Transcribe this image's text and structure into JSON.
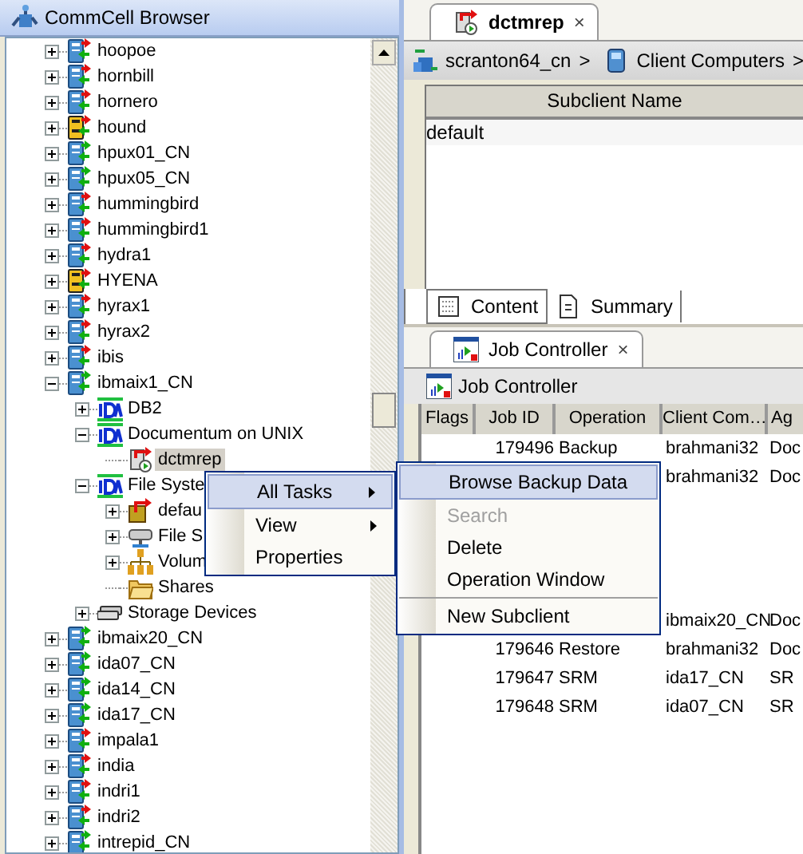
{
  "browser": {
    "title": "CommCell Browser",
    "tree": [
      {
        "label": "hoopoe",
        "kind": "client_alert",
        "expanded": false,
        "selected": false
      },
      {
        "label": "hornbill",
        "kind": "client_alert",
        "expanded": false,
        "selected": false
      },
      {
        "label": "hornero",
        "kind": "client_alert",
        "expanded": false,
        "selected": false
      },
      {
        "label": "hound",
        "kind": "client_legacy",
        "expanded": false,
        "selected": false
      },
      {
        "label": "hpux01_CN",
        "kind": "client_ok",
        "expanded": false,
        "selected": false
      },
      {
        "label": "hpux05_CN",
        "kind": "client_ok",
        "expanded": false,
        "selected": false
      },
      {
        "label": "hummingbird",
        "kind": "client_alert",
        "expanded": false,
        "selected": false
      },
      {
        "label": "hummingbird1",
        "kind": "client_alert",
        "expanded": false,
        "selected": false
      },
      {
        "label": "hydra1",
        "kind": "client_alert",
        "expanded": false,
        "selected": false
      },
      {
        "label": "HYENA",
        "kind": "client_legacy",
        "expanded": false,
        "selected": false
      },
      {
        "label": "hyrax1",
        "kind": "client_alert",
        "expanded": false,
        "selected": false
      },
      {
        "label": "hyrax2",
        "kind": "client_alert",
        "expanded": false,
        "selected": false
      },
      {
        "label": "ibis",
        "kind": "client_alert",
        "expanded": false,
        "selected": false
      },
      {
        "label": "ibmaix1_CN",
        "kind": "client_ok",
        "expanded": true,
        "selected": false,
        "children": [
          {
            "label": "DB2",
            "kind": "agent",
            "expanded": false,
            "selected": false
          },
          {
            "label": "Documentum on UNIX",
            "kind": "agent",
            "expanded": true,
            "selected": false,
            "children": [
              {
                "label": "dctmrep",
                "kind": "subclient",
                "selected": true
              }
            ]
          },
          {
            "label": "File Syste",
            "kind": "agent",
            "expanded": true,
            "selected": false,
            "children": [
              {
                "label": "defau",
                "kind": "default_subclient",
                "expanded": false,
                "selected": false
              },
              {
                "label": "File S",
                "kind": "drive",
                "expanded": false,
                "selected": false
              },
              {
                "label": "Volum",
                "kind": "volume_groups",
                "expanded": false,
                "selected": false
              },
              {
                "label": "Shares",
                "kind": "shares",
                "selected": false
              }
            ]
          },
          {
            "label": "Storage Devices",
            "kind": "storage",
            "expanded": false,
            "selected": false
          }
        ]
      },
      {
        "label": "ibmaix20_CN",
        "kind": "client_ok",
        "expanded": false,
        "selected": false
      },
      {
        "label": "ida07_CN",
        "kind": "client_ok",
        "expanded": false,
        "selected": false
      },
      {
        "label": "ida14_CN",
        "kind": "client_ok",
        "expanded": false,
        "selected": false
      },
      {
        "label": "ida17_CN",
        "kind": "client_ok",
        "expanded": false,
        "selected": false
      },
      {
        "label": "impala1",
        "kind": "client_alert",
        "expanded": false,
        "selected": false
      },
      {
        "label": "india",
        "kind": "client_alert",
        "expanded": false,
        "selected": false
      },
      {
        "label": "indri1",
        "kind": "client_alert",
        "expanded": false,
        "selected": false
      },
      {
        "label": "indri2",
        "kind": "client_alert",
        "expanded": false,
        "selected": false
      },
      {
        "label": "intrepid_CN",
        "kind": "client_ok",
        "expanded": false,
        "selected": false
      }
    ]
  },
  "editor": {
    "tabs": [
      {
        "label": "dctmrep",
        "close": "×",
        "selected": true
      }
    ],
    "breadcrumb": [
      {
        "label": "scranton64_cn",
        "kind": "commcell"
      },
      {
        "label": "Client Computers",
        "kind": "computers"
      }
    ],
    "separator": ">",
    "table": {
      "columns": [
        "Subclient Name"
      ],
      "rows": [
        [
          "default"
        ]
      ]
    },
    "view_tabs": [
      {
        "label": "Content",
        "kind": "grid",
        "selected": true
      },
      {
        "label": "Summary",
        "kind": "summary",
        "selected": false
      }
    ]
  },
  "job_panel": {
    "tabs": [
      {
        "label": "Job Controller",
        "close": "×",
        "selected": true
      }
    ],
    "toolbar_title": "Job Controller",
    "columns": [
      "Flags",
      "Job ID",
      "Operation",
      "Client Com…",
      "Ag"
    ],
    "rows": [
      {
        "job_id": "179496",
        "operation": "Backup",
        "client": "brahmani32",
        "agent": "Doc"
      },
      {
        "client": "brahmani32",
        "agent": "Doc"
      },
      {
        "client": "ibmaix20_CN",
        "agent": "Doc"
      },
      {
        "job_id": "179646",
        "operation": "Restore",
        "client": "brahmani32",
        "agent": "Doc"
      },
      {
        "job_id": "179647",
        "operation": "SRM",
        "client": "ida17_CN",
        "agent": "SR"
      },
      {
        "job_id": "179648",
        "operation": "SRM",
        "client": "ida07_CN",
        "agent": "SR"
      }
    ]
  },
  "context_menu": {
    "items": [
      {
        "label": "All Tasks",
        "submenu": true,
        "selected": true
      },
      {
        "label": "View",
        "submenu": true,
        "selected": false
      },
      {
        "label": "Properties",
        "submenu": false,
        "selected": false
      }
    ]
  },
  "submenu": {
    "items": [
      {
        "label": "Browse Backup Data",
        "selected": true,
        "disabled": false
      },
      {
        "label": "Search",
        "selected": false,
        "disabled": true
      },
      {
        "label": "Delete",
        "selected": false,
        "disabled": false
      },
      {
        "label": "Operation Window",
        "selected": false,
        "disabled": false
      },
      {
        "kind": "separator"
      },
      {
        "label": "New Subclient",
        "selected": false,
        "disabled": false
      }
    ]
  }
}
